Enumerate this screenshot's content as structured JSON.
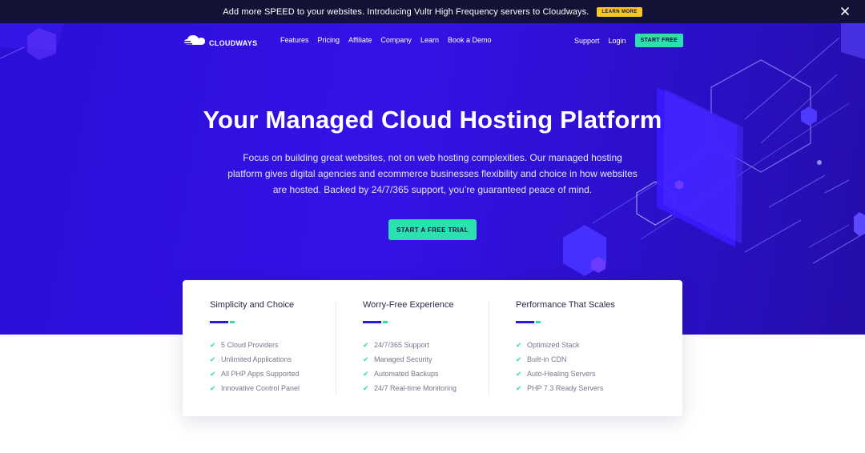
{
  "announcement": {
    "text": "Add more SPEED to your websites. Introducing Vultr High Frequency servers to Cloudways.",
    "button": "LEARN MORE"
  },
  "nav": {
    "logo_text": "CLOUDWAYS",
    "links": [
      "Features",
      "Pricing",
      "Affiliate",
      "Company",
      "Learn",
      "Book a Demo"
    ],
    "support": "Support",
    "login": "Login",
    "cta": "START FREE"
  },
  "hero": {
    "title": "Your Managed Cloud Hosting Platform",
    "subtitle": "Focus on building great websites, not on web hosting complexities. Our managed hosting platform gives digital agencies and ecommerce businesses flexibility and choice in how websites are hosted. Backed by 24/7/365 support, you’re guaranteed peace of mind.",
    "cta": "START A FREE TRIAL"
  },
  "features": [
    {
      "title": "Simplicity and Choice",
      "items": [
        "5 Cloud Providers",
        "Unlimited Applications",
        "All PHP Apps Supported",
        "Innovative Control Panel"
      ]
    },
    {
      "title": "Worry-Free Experience",
      "items": [
        "24/7/365 Support",
        "Managed Security",
        "Automated Backups",
        "24/7 Real-time Monitoring"
      ]
    },
    {
      "title": "Performance That Scales",
      "items": [
        "Optimized Stack",
        "Built-in CDN",
        "Auto-Healing Servers",
        "PHP 7.3 Ready Servers"
      ]
    }
  ],
  "icons": {
    "close": "close-icon",
    "logo": "cloud-logo-icon",
    "check": "check-icon"
  },
  "colors": {
    "hero_bg": "#3412e6",
    "accent_green": "#2ce0b0",
    "announce_bg": "#121236",
    "learn_more_bg": "#f9c623",
    "bar_blue": "#2b1ad6"
  }
}
